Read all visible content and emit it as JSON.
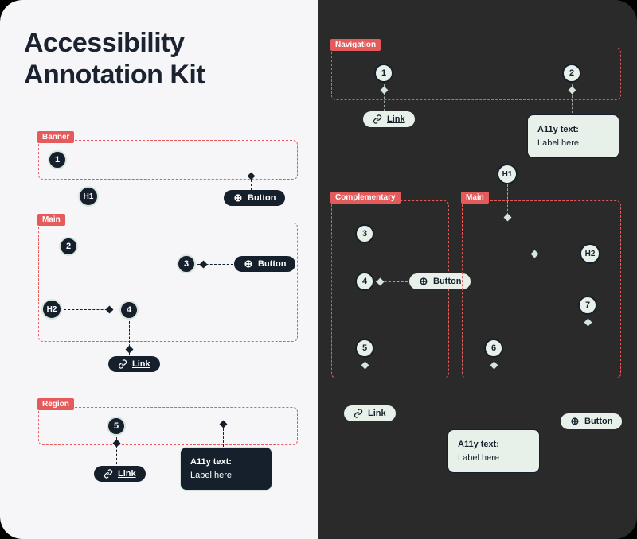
{
  "title": "Accessibility\nAnnotation Kit",
  "light_side": {
    "regions": {
      "banner": "Banner",
      "main": "Main",
      "region": "Region"
    },
    "nodes": {
      "n1": "1",
      "n2": "2",
      "n3": "3",
      "n4": "4",
      "n5": "5"
    },
    "headings": {
      "h1": "H1",
      "h2": "H2"
    },
    "button_label": "Button",
    "link_label": "Link",
    "a11y": {
      "title": "A11y text:",
      "value": "Label here"
    }
  },
  "dark_side": {
    "regions": {
      "navigation": "Navigation",
      "complementary": "Complementary",
      "main": "Main"
    },
    "nodes": {
      "n1": "1",
      "n2": "2",
      "n3": "3",
      "n4": "4",
      "n5": "5",
      "n6": "6",
      "n7": "7"
    },
    "headings": {
      "h1": "H1",
      "h2": "H2"
    },
    "button_label": "Button",
    "link_label": "Link",
    "a11y": {
      "title": "A11y text:",
      "value": "Label here"
    }
  }
}
